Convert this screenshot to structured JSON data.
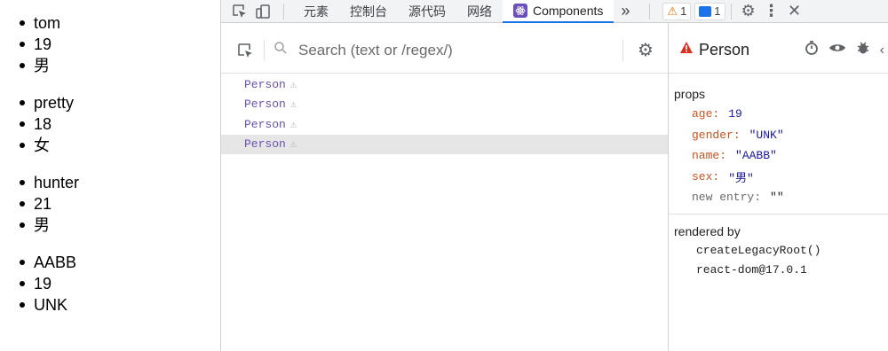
{
  "page": {
    "groups": [
      [
        "tom",
        "19",
        "男"
      ],
      [
        "pretty",
        "18",
        "女"
      ],
      [
        "hunter",
        "21",
        "男"
      ],
      [
        "AABB",
        "19",
        "UNK"
      ]
    ]
  },
  "devtools": {
    "tabs": [
      "元素",
      "控制台",
      "源代码",
      "网络",
      "Components"
    ],
    "more_tabs_glyph": "»",
    "warning_count": "1",
    "message_count": "1"
  },
  "components": {
    "search_placeholder": "Search (text or /regex/)",
    "tree": [
      "Person",
      "Person",
      "Person",
      "Person"
    ],
    "selected_index": 3
  },
  "inspector": {
    "component_name": "Person",
    "props_title": "props",
    "props": [
      {
        "key": "age",
        "value": "19"
      },
      {
        "key": "gender",
        "value": "\"UNK\""
      },
      {
        "key": "name",
        "value": "\"AABB\""
      },
      {
        "key": "sex",
        "value": "\"男\""
      }
    ],
    "new_entry_key": "new entry",
    "new_entry_value": "\"\"",
    "rendered_by_title": "rendered by",
    "rendered_by": [
      "createLegacyRoot()",
      "react-dom@17.0.1"
    ]
  },
  "colors": {
    "accent": "#1a73e8",
    "component_name": "#6a51b2",
    "prop_key": "#c8531f",
    "prop_value": "#1a1aa6",
    "warning": "#e37400",
    "error": "#d93025"
  }
}
